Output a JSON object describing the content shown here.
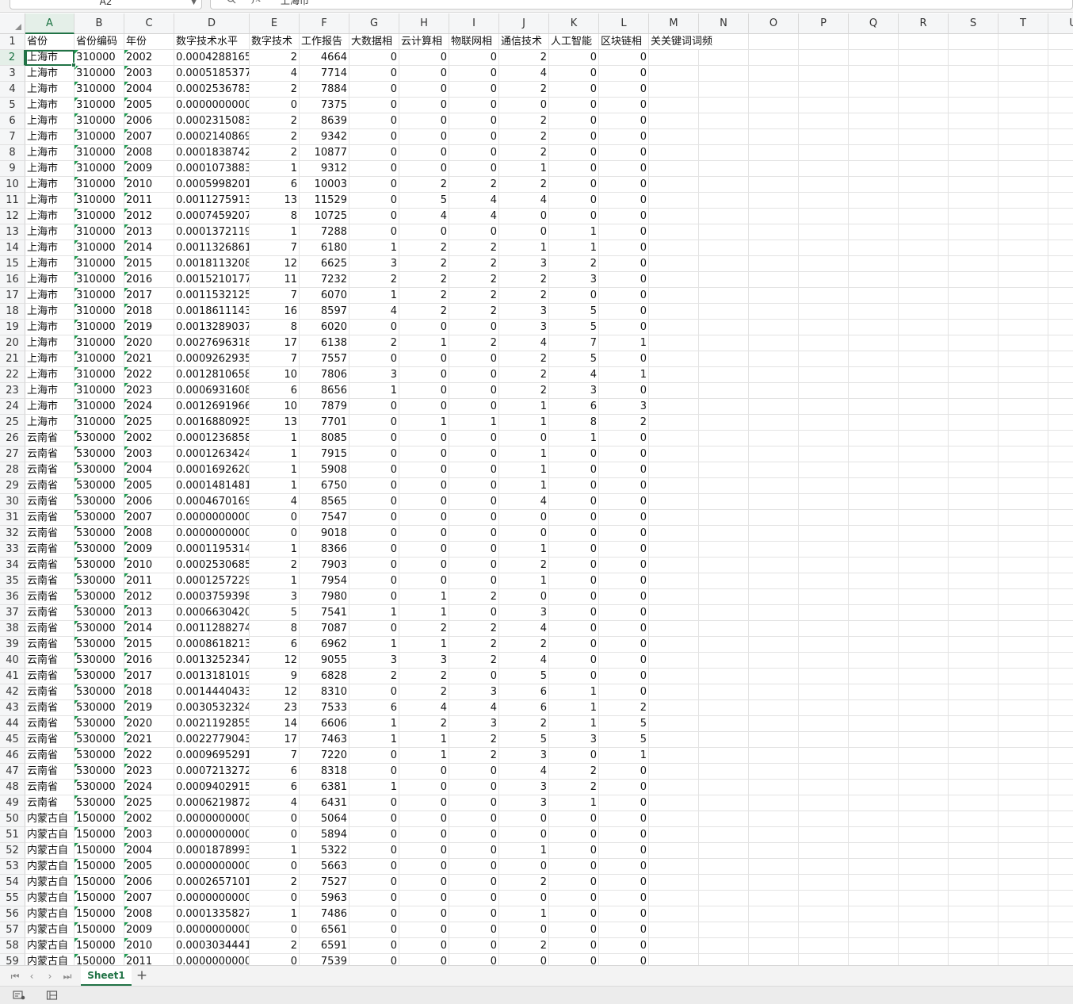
{
  "formula_bar": {
    "name_box": "A2",
    "fx_label": "fx",
    "value": "上海市"
  },
  "columns": [
    "A",
    "B",
    "C",
    "D",
    "E",
    "F",
    "G",
    "H",
    "I",
    "J",
    "K",
    "L",
    "M",
    "N",
    "O",
    "P",
    "Q",
    "R",
    "S",
    "T",
    "U"
  ],
  "header_row": [
    "省份",
    "省份编码",
    "年份",
    "数字技术水平",
    "数字技术",
    "工作报告",
    "大数据相",
    "云计算相",
    "物联网相",
    "通信技术",
    "人工智能",
    "区块链相",
    "关关键词词频"
  ],
  "rows": [
    [
      "上海市",
      "310000",
      "2002",
      "0.0004288165",
      "2",
      "4664",
      "0",
      "0",
      "0",
      "2",
      "0",
      "0"
    ],
    [
      "上海市",
      "310000",
      "2003",
      "0.0005185377",
      "4",
      "7714",
      "0",
      "0",
      "0",
      "4",
      "0",
      "0"
    ],
    [
      "上海市",
      "310000",
      "2004",
      "0.0002536783",
      "2",
      "7884",
      "0",
      "0",
      "0",
      "2",
      "0",
      "0"
    ],
    [
      "上海市",
      "310000",
      "2005",
      "0.0000000000",
      "0",
      "7375",
      "0",
      "0",
      "0",
      "0",
      "0",
      "0"
    ],
    [
      "上海市",
      "310000",
      "2006",
      "0.0002315083",
      "2",
      "8639",
      "0",
      "0",
      "0",
      "2",
      "0",
      "0"
    ],
    [
      "上海市",
      "310000",
      "2007",
      "0.0002140869",
      "2",
      "9342",
      "0",
      "0",
      "0",
      "2",
      "0",
      "0"
    ],
    [
      "上海市",
      "310000",
      "2008",
      "0.0001838742",
      "2",
      "10877",
      "0",
      "0",
      "0",
      "2",
      "0",
      "0"
    ],
    [
      "上海市",
      "310000",
      "2009",
      "0.0001073883",
      "1",
      "9312",
      "0",
      "0",
      "0",
      "1",
      "0",
      "0"
    ],
    [
      "上海市",
      "310000",
      "2010",
      "0.0005998201",
      "6",
      "10003",
      "0",
      "2",
      "2",
      "2",
      "0",
      "0"
    ],
    [
      "上海市",
      "310000",
      "2011",
      "0.0011275913",
      "13",
      "11529",
      "0",
      "5",
      "4",
      "4",
      "0",
      "0"
    ],
    [
      "上海市",
      "310000",
      "2012",
      "0.0007459207",
      "8",
      "10725",
      "0",
      "4",
      "4",
      "0",
      "0",
      "0"
    ],
    [
      "上海市",
      "310000",
      "2013",
      "0.0001372119",
      "1",
      "7288",
      "0",
      "0",
      "0",
      "0",
      "1",
      "0"
    ],
    [
      "上海市",
      "310000",
      "2014",
      "0.0011326861",
      "7",
      "6180",
      "1",
      "2",
      "2",
      "1",
      "1",
      "0"
    ],
    [
      "上海市",
      "310000",
      "2015",
      "0.0018113208",
      "12",
      "6625",
      "3",
      "2",
      "2",
      "3",
      "2",
      "0"
    ],
    [
      "上海市",
      "310000",
      "2016",
      "0.0015210177",
      "11",
      "7232",
      "2",
      "2",
      "2",
      "2",
      "3",
      "0"
    ],
    [
      "上海市",
      "310000",
      "2017",
      "0.0011532125",
      "7",
      "6070",
      "1",
      "2",
      "2",
      "2",
      "0",
      "0"
    ],
    [
      "上海市",
      "310000",
      "2018",
      "0.0018611143",
      "16",
      "8597",
      "4",
      "2",
      "2",
      "3",
      "5",
      "0"
    ],
    [
      "上海市",
      "310000",
      "2019",
      "0.0013289037",
      "8",
      "6020",
      "0",
      "0",
      "0",
      "3",
      "5",
      "0"
    ],
    [
      "上海市",
      "310000",
      "2020",
      "0.0027696318",
      "17",
      "6138",
      "2",
      "1",
      "2",
      "4",
      "7",
      "1"
    ],
    [
      "上海市",
      "310000",
      "2021",
      "0.0009262935",
      "7",
      "7557",
      "0",
      "0",
      "0",
      "2",
      "5",
      "0"
    ],
    [
      "上海市",
      "310000",
      "2022",
      "0.0012810658",
      "10",
      "7806",
      "3",
      "0",
      "0",
      "2",
      "4",
      "1"
    ],
    [
      "上海市",
      "310000",
      "2023",
      "0.0006931608",
      "6",
      "8656",
      "1",
      "0",
      "0",
      "2",
      "3",
      "0"
    ],
    [
      "上海市",
      "310000",
      "2024",
      "0.0012691966",
      "10",
      "7879",
      "0",
      "0",
      "0",
      "1",
      "6",
      "3"
    ],
    [
      "上海市",
      "310000",
      "2025",
      "0.0016880925",
      "13",
      "7701",
      "0",
      "1",
      "1",
      "1",
      "8",
      "2"
    ],
    [
      "云南省",
      "530000",
      "2002",
      "0.0001236858",
      "1",
      "8085",
      "0",
      "0",
      "0",
      "0",
      "1",
      "0"
    ],
    [
      "云南省",
      "530000",
      "2003",
      "0.0001263424",
      "1",
      "7915",
      "0",
      "0",
      "0",
      "1",
      "0",
      "0"
    ],
    [
      "云南省",
      "530000",
      "2004",
      "0.0001692620",
      "1",
      "5908",
      "0",
      "0",
      "0",
      "1",
      "0",
      "0"
    ],
    [
      "云南省",
      "530000",
      "2005",
      "0.0001481481",
      "1",
      "6750",
      "0",
      "0",
      "0",
      "1",
      "0",
      "0"
    ],
    [
      "云南省",
      "530000",
      "2006",
      "0.0004670169",
      "4",
      "8565",
      "0",
      "0",
      "0",
      "4",
      "0",
      "0"
    ],
    [
      "云南省",
      "530000",
      "2007",
      "0.0000000000",
      "0",
      "7547",
      "0",
      "0",
      "0",
      "0",
      "0",
      "0"
    ],
    [
      "云南省",
      "530000",
      "2008",
      "0.0000000000",
      "0",
      "9018",
      "0",
      "0",
      "0",
      "0",
      "0",
      "0"
    ],
    [
      "云南省",
      "530000",
      "2009",
      "0.0001195314",
      "1",
      "8366",
      "0",
      "0",
      "0",
      "1",
      "0",
      "0"
    ],
    [
      "云南省",
      "530000",
      "2010",
      "0.0002530685",
      "2",
      "7903",
      "0",
      "0",
      "0",
      "2",
      "0",
      "0"
    ],
    [
      "云南省",
      "530000",
      "2011",
      "0.0001257229",
      "1",
      "7954",
      "0",
      "0",
      "0",
      "1",
      "0",
      "0"
    ],
    [
      "云南省",
      "530000",
      "2012",
      "0.0003759398",
      "3",
      "7980",
      "0",
      "1",
      "2",
      "0",
      "0",
      "0"
    ],
    [
      "云南省",
      "530000",
      "2013",
      "0.0006630420",
      "5",
      "7541",
      "1",
      "1",
      "0",
      "3",
      "0",
      "0"
    ],
    [
      "云南省",
      "530000",
      "2014",
      "0.0011288274",
      "8",
      "7087",
      "0",
      "2",
      "2",
      "4",
      "0",
      "0"
    ],
    [
      "云南省",
      "530000",
      "2015",
      "0.0008618213",
      "6",
      "6962",
      "1",
      "1",
      "2",
      "2",
      "0",
      "0"
    ],
    [
      "云南省",
      "530000",
      "2016",
      "0.0013252347",
      "12",
      "9055",
      "3",
      "3",
      "2",
      "4",
      "0",
      "0"
    ],
    [
      "云南省",
      "530000",
      "2017",
      "0.0013181019",
      "9",
      "6828",
      "2",
      "2",
      "0",
      "5",
      "0",
      "0"
    ],
    [
      "云南省",
      "530000",
      "2018",
      "0.0014440433",
      "12",
      "8310",
      "0",
      "2",
      "3",
      "6",
      "1",
      "0"
    ],
    [
      "云南省",
      "530000",
      "2019",
      "0.0030532324",
      "23",
      "7533",
      "6",
      "4",
      "4",
      "6",
      "1",
      "2"
    ],
    [
      "云南省",
      "530000",
      "2020",
      "0.0021192855",
      "14",
      "6606",
      "1",
      "2",
      "3",
      "2",
      "1",
      "5"
    ],
    [
      "云南省",
      "530000",
      "2021",
      "0.0022779043",
      "17",
      "7463",
      "1",
      "1",
      "2",
      "5",
      "3",
      "5"
    ],
    [
      "云南省",
      "530000",
      "2022",
      "0.0009695291",
      "7",
      "7220",
      "0",
      "1",
      "2",
      "3",
      "0",
      "1"
    ],
    [
      "云南省",
      "530000",
      "2023",
      "0.0007213272",
      "6",
      "8318",
      "0",
      "0",
      "0",
      "4",
      "2",
      "0"
    ],
    [
      "云南省",
      "530000",
      "2024",
      "0.0009402915",
      "6",
      "6381",
      "1",
      "0",
      "0",
      "3",
      "2",
      "0"
    ],
    [
      "云南省",
      "530000",
      "2025",
      "0.0006219872",
      "4",
      "6431",
      "0",
      "0",
      "0",
      "3",
      "1",
      "0"
    ],
    [
      "内蒙古自",
      "150000",
      "2002",
      "0.0000000000",
      "0",
      "5064",
      "0",
      "0",
      "0",
      "0",
      "0",
      "0"
    ],
    [
      "内蒙古自",
      "150000",
      "2003",
      "0.0000000000",
      "0",
      "5894",
      "0",
      "0",
      "0",
      "0",
      "0",
      "0"
    ],
    [
      "内蒙古自",
      "150000",
      "2004",
      "0.0001878993",
      "1",
      "5322",
      "0",
      "0",
      "0",
      "1",
      "0",
      "0"
    ],
    [
      "内蒙古自",
      "150000",
      "2005",
      "0.0000000000",
      "0",
      "5663",
      "0",
      "0",
      "0",
      "0",
      "0",
      "0"
    ],
    [
      "内蒙古自",
      "150000",
      "2006",
      "0.0002657101",
      "2",
      "7527",
      "0",
      "0",
      "0",
      "2",
      "0",
      "0"
    ],
    [
      "内蒙古自",
      "150000",
      "2007",
      "0.0000000000",
      "0",
      "5963",
      "0",
      "0",
      "0",
      "0",
      "0",
      "0"
    ],
    [
      "内蒙古自",
      "150000",
      "2008",
      "0.0001335827",
      "1",
      "7486",
      "0",
      "0",
      "0",
      "1",
      "0",
      "0"
    ],
    [
      "内蒙古自",
      "150000",
      "2009",
      "0.0000000000",
      "0",
      "6561",
      "0",
      "0",
      "0",
      "0",
      "0",
      "0"
    ],
    [
      "内蒙古自",
      "150000",
      "2010",
      "0.0003034441",
      "2",
      "6591",
      "0",
      "0",
      "0",
      "2",
      "0",
      "0"
    ],
    [
      "内蒙古自",
      "150000",
      "2011",
      "0.0000000000",
      "0",
      "7539",
      "0",
      "0",
      "0",
      "0",
      "0",
      "0"
    ]
  ],
  "sheet_tabs": {
    "first_icon": "first-sheet-icon",
    "prev_icon": "prev-sheet-icon",
    "next_icon": "next-sheet-icon",
    "last_icon": "last-sheet-icon",
    "active": "Sheet1",
    "add_icon": "add-sheet-icon"
  },
  "status_bar": {
    "left_icon": "macro-record-icon",
    "right_icon": "cell-mode-icon"
  },
  "colors": {
    "accent": "#217346",
    "string_marker": "#1e9d52",
    "header_bg": "#f5f6f7"
  }
}
